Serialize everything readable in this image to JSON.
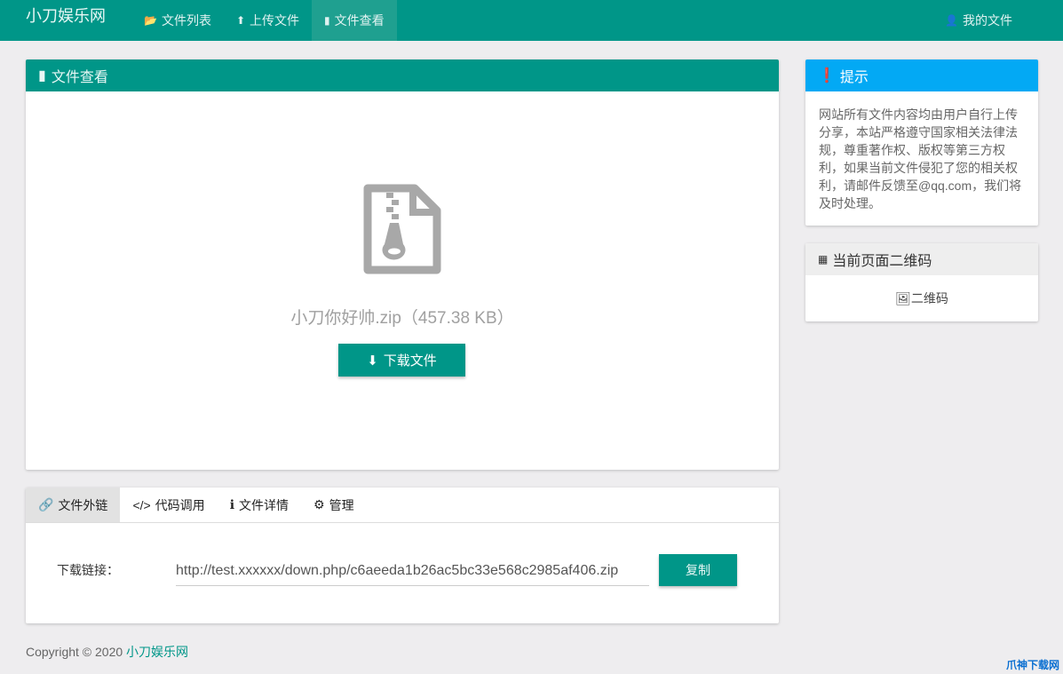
{
  "nav": {
    "brand": "小刀娱乐网",
    "items": [
      {
        "label": "文件列表",
        "icon": "folder-open-icon"
      },
      {
        "label": "上传文件",
        "icon": "upload-icon"
      },
      {
        "label": "文件查看",
        "icon": "file-icon"
      }
    ],
    "user": "我的文件"
  },
  "main": {
    "title": "文件查看",
    "file_name": "小刀你好帅.zip（457.38 KB）",
    "download": "下载文件"
  },
  "tabs": {
    "items": [
      "文件外链",
      "代码调用",
      "文件详情",
      "管理"
    ],
    "link_label": "下载链接：",
    "link_value": "http://test.xxxxxx/down.php/c6aeeda1b26ac5bc33e568c2985af406.zip",
    "copy": "复制"
  },
  "tip": {
    "title": "提示",
    "body": "网站所有文件内容均由用户自行上传分享，本站严格遵守国家相关法律法规，尊重著作权、版权等第三方权利，如果当前文件侵犯了您的相关权利，请邮件反馈至@qq.com，我们将及时处理。"
  },
  "qr": {
    "title": "当前页面二维码",
    "alt": "二维码"
  },
  "footer": {
    "text": "Copyright © 2020 ",
    "link": "小刀娱乐网"
  },
  "watermark": "爪神下载网",
  "colors": {
    "primary": "#009688",
    "info": "#03a9f4"
  }
}
